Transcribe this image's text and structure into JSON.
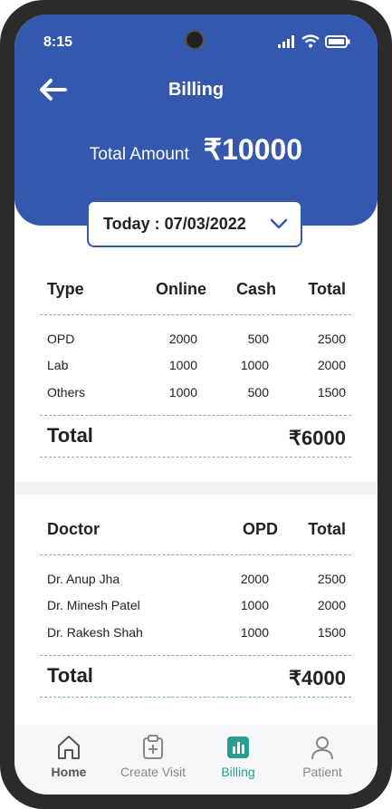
{
  "status": {
    "time": "8:15"
  },
  "header": {
    "title": "Billing",
    "total_label": "Total Amount",
    "total_value": "₹10000"
  },
  "date_selector": {
    "label": "Today : 07/03/2022"
  },
  "type_table": {
    "headers": [
      "Type",
      "Online",
      "Cash",
      "Total"
    ],
    "rows": [
      {
        "type": "OPD",
        "online": "2000",
        "cash": "500",
        "total": "2500"
      },
      {
        "type": "Lab",
        "online": "1000",
        "cash": "1000",
        "total": "2000"
      },
      {
        "type": "Others",
        "online": "1000",
        "cash": "500",
        "total": "1500"
      }
    ],
    "total_label": "Total",
    "total_value": "₹6000"
  },
  "doctor_table": {
    "headers": [
      "Doctor",
      "OPD",
      "Total"
    ],
    "rows": [
      {
        "doctor": "Dr. Anup Jha",
        "opd": "2000",
        "total": "2500"
      },
      {
        "doctor": "Dr. Minesh Patel",
        "opd": "1000",
        "total": "2000"
      },
      {
        "doctor": "Dr. Rakesh Shah",
        "opd": "1000",
        "total": "1500"
      }
    ],
    "total_label": "Total",
    "total_value": "₹4000"
  },
  "nav": {
    "items": [
      {
        "label": "Home",
        "icon": "home-icon"
      },
      {
        "label": "Create Visit",
        "icon": "clipboard-plus-icon"
      },
      {
        "label": "Billing",
        "icon": "bar-chart-icon"
      },
      {
        "label": "Patient",
        "icon": "user-icon"
      }
    ],
    "active_color": "#2a9d8f",
    "active_index": 2
  },
  "colors": {
    "primary": "#3358ad",
    "accent": "#2a9d8f"
  }
}
